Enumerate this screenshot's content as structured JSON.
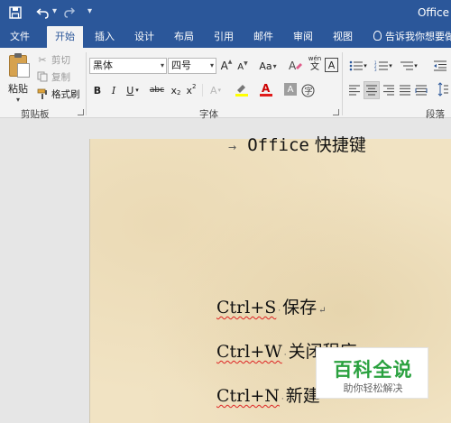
{
  "window": {
    "title": "Office"
  },
  "quick_access": {
    "save_icon": "save-icon",
    "undo_icon": "undo-icon",
    "redo_icon": "redo-icon",
    "customize_icon": "customize-icon"
  },
  "ribbon_tabs": [
    "文件",
    "开始",
    "插入",
    "设计",
    "布局",
    "引用",
    "邮件",
    "审阅",
    "视图"
  ],
  "active_tab": "开始",
  "tell_me": "告诉我你想要做",
  "clipboard_group": {
    "label": "剪贴板",
    "paste": "粘贴",
    "cut": "剪切",
    "copy": "复制",
    "format_painter": "格式刷"
  },
  "font_group": {
    "label": "字体",
    "font_name": "黑体",
    "font_size": "四号",
    "grow": "A",
    "shrink": "A",
    "change_case": "Aa",
    "phonetic": "wén",
    "bold": "B",
    "italic": "I",
    "underline": "U",
    "strikethrough": "abc",
    "subscript": "x",
    "superscript": "x",
    "highlight_color": "#ffff00",
    "font_color": "#e01b1b"
  },
  "paragraph_group": {
    "label": "段落"
  },
  "document": {
    "title_latin": "Office",
    "title_cjk": "快捷键",
    "lines": [
      {
        "key": "Ctrl+S",
        "desc": "保存"
      },
      {
        "key": "Ctrl+W",
        "desc": "关闭程序"
      },
      {
        "key": "Ctrl+N",
        "desc": "新建"
      }
    ]
  },
  "watermark": {
    "title": "百科全说",
    "subtitle": "助你轻松解决"
  }
}
